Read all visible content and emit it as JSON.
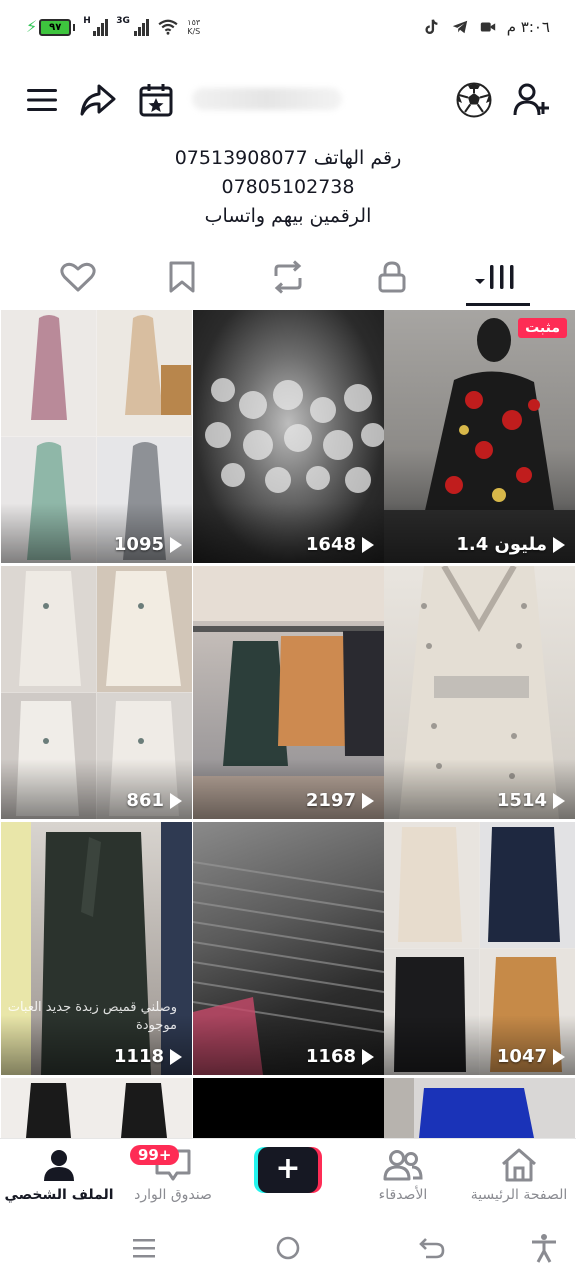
{
  "status_bar": {
    "time": "٣:٠٦ م",
    "battery": "٩٧",
    "network_1": "H",
    "network_2": "3G",
    "speed_value": "١٥٣",
    "speed_unit": "K/S"
  },
  "bio": {
    "line1": "رقم الهاتف 07513908077",
    "line2": "07805102738",
    "line3": "الرقمين بيهم واتساب"
  },
  "tabs": [
    "videos",
    "private",
    "reposts",
    "favorites",
    "liked"
  ],
  "grid": {
    "pinned_label": "مثبت",
    "tiles": [
      {
        "views": "1.4 مليون",
        "pinned": true
      },
      {
        "views": "1648"
      },
      {
        "views": "1095"
      },
      {
        "views": "1514"
      },
      {
        "views": "2197"
      },
      {
        "views": "861"
      },
      {
        "views": "1047"
      },
      {
        "views": "1168"
      },
      {
        "views": "1118",
        "caption": "وصلني قميص زبدة جديد العبات موجودة"
      }
    ]
  },
  "bottom_nav": {
    "home": "الصفحة الرئيسية",
    "friends": "الأصدقاء",
    "create": "+",
    "inbox": "صندوق الوارد",
    "inbox_badge": "99+",
    "profile": "الملف الشخصي"
  },
  "colors": {
    "accent": "#fe2c55",
    "cyan": "#25f4ee",
    "text": "#161823"
  }
}
